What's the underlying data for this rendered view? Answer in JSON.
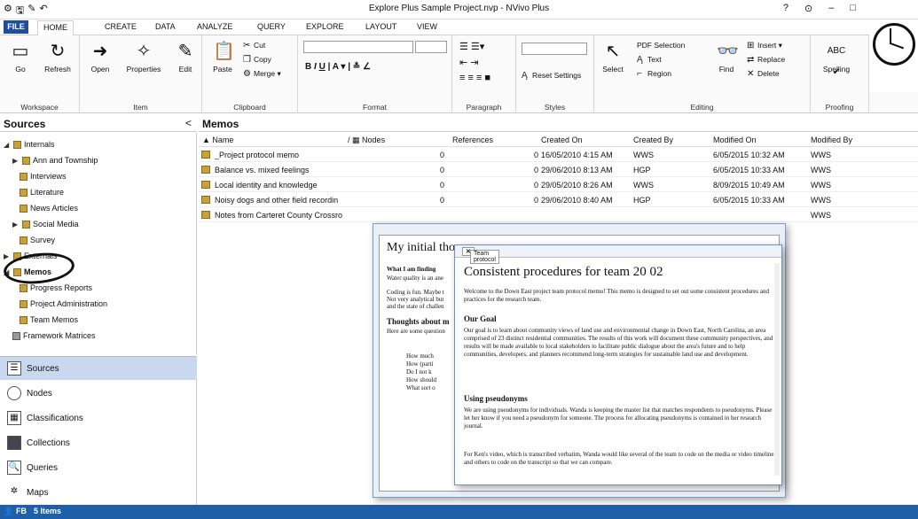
{
  "titlebar": {
    "title": "Explore Plus Sample Project.nvp - NVivo Plus",
    "help": "?",
    "min": "–",
    "max": "□"
  },
  "tabs": [
    "FILE",
    "HOME",
    "CREATE",
    "DATA",
    "ANALYZE",
    "QUERY",
    "EXPLORE",
    "LAYOUT",
    "VIEW"
  ],
  "ribbon": {
    "workspace": {
      "name": "Workspace",
      "go": "Go",
      "refresh": "Refresh"
    },
    "item": {
      "name": "Item",
      "open": "Open",
      "properties": "Properties",
      "edit": "Edit"
    },
    "clipboard": {
      "name": "Clipboard",
      "paste": "Paste",
      "cut": "Cut",
      "copy": "Copy",
      "merge": "Merge"
    },
    "format": {
      "name": "Format"
    },
    "paragraph": {
      "name": "Paragraph"
    },
    "styles": {
      "name": "Styles",
      "reset": "Reset Settings"
    },
    "editing": {
      "name": "Editing",
      "select": "Select",
      "pdf_selection": "PDF Selection",
      "text": "Text",
      "region": "Region",
      "find": "Find",
      "insert": "Insert",
      "replace": "Replace",
      "delete": "Delete"
    },
    "proofing": {
      "name": "Proofing",
      "spelling": "Spelling",
      "abc": "ABC"
    }
  },
  "sources": {
    "title": "Sources",
    "collapse": "<",
    "tree": [
      {
        "label": "Internals"
      },
      {
        "label": "Ann and Township"
      },
      {
        "label": "Interviews"
      },
      {
        "label": "Literature"
      },
      {
        "label": "News Articles"
      },
      {
        "label": "Social Media"
      },
      {
        "label": "Survey"
      },
      {
        "label": "Externals"
      },
      {
        "label": "Memos"
      },
      {
        "label": "Progress Reports"
      },
      {
        "label": "Project Administration"
      },
      {
        "label": "Team Memos"
      },
      {
        "label": "Framework Matrices"
      }
    ]
  },
  "nav": [
    {
      "label": "Sources"
    },
    {
      "label": "Nodes"
    },
    {
      "label": "Classifications"
    },
    {
      "label": "Collections"
    },
    {
      "label": "Queries"
    },
    {
      "label": "Maps"
    }
  ],
  "memos": {
    "title": "Memos",
    "columns": [
      "Name",
      "Nodes",
      "References",
      "Created On",
      "Created By",
      "Modified On",
      "Modified By"
    ],
    "rows": [
      {
        "name": "_Project protocol memo",
        "nodes": "0",
        "refs": "0",
        "created": "16/05/2010 4:15 AM",
        "by": "WWS",
        "modified": "6/05/2015 10:32 AM",
        "mby": "WWS"
      },
      {
        "name": "Balance vs. mixed feelings",
        "nodes": "0",
        "refs": "0",
        "created": "29/06/2010 8:13 AM",
        "by": "HGP",
        "modified": "6/05/2015 10:33 AM",
        "mby": "WWS"
      },
      {
        "name": "Local identity and knowledge",
        "nodes": "0",
        "refs": "0",
        "created": "29/05/2010 8:26 AM",
        "by": "WWS",
        "modified": "8/09/2015 10:49 AM",
        "mby": "WWS"
      },
      {
        "name": "Noisy dogs and other field recordin",
        "nodes": "0",
        "refs": "0",
        "created": "29/06/2010 8:40 AM",
        "by": "HGP",
        "modified": "6/05/2015 10:33 AM",
        "mby": "WWS"
      },
      {
        "name": "Notes from Carteret County Crossro",
        "nodes": "",
        "refs": "",
        "created": "",
        "by": "",
        "modified": "",
        "mby": "WWS"
      }
    ]
  },
  "memo_back": {
    "title": "My initial tho",
    "lines": [
      "What I am finding",
      "Water quality is an ane",
      "Coding is fun. Maybe t",
      "Not very analytical but",
      "and the state of challen",
      "Thoughts about m",
      "Here are some question",
      "How much",
      "How (parti",
      "Do I not k",
      "How should",
      "What sort o"
    ]
  },
  "memo_front": {
    "tab": "Team protocol",
    "title": "Consistent procedures for team 20 02",
    "intro": "Welcome to the Down East project team protocol memo! This memo is designed to set out some consistent procedures and practices for the research team.",
    "goal_head": "Our Goal",
    "goal": "Our goal is to learn about community views of land use and environmental change in Down East, North Carolina, an area comprised of 23 distinct residential communities. The results of this work will document these community perspectives, and results will be made available to local stakeholders to facilitate public dialogue about the area's future and to help communities, developers, and planners recommend long-term strategies for sustainable land use and development.",
    "pseud_head": "Using pseudonyms",
    "pseud": "We are using pseudonyms for individuals. Wanda is keeping the master list that matches respondents to pseudonyms. Please let her know if you need a pseudonym for someone. The process for allocating pseudonyms is contained in her research journal.",
    "video": "For Ken's video, which is transcribed verbatim, Wanda would like several of the team to code on the media or video timeline and others to code on the transcript so that we can compare."
  },
  "status": {
    "user": "FB",
    "items": "5 Items"
  }
}
